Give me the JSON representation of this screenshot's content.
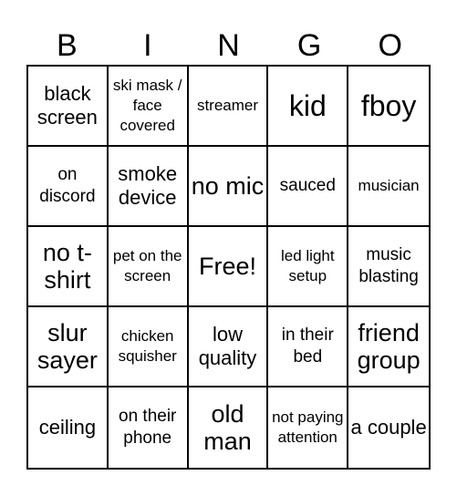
{
  "header": {
    "letters": [
      "B",
      "I",
      "N",
      "G",
      "O"
    ]
  },
  "board": {
    "rows": [
      [
        {
          "text": "black screen",
          "size": "m"
        },
        {
          "text": "ski mask / face covered",
          "size": "xs"
        },
        {
          "text": "streamer",
          "size": "xs"
        },
        {
          "text": "kid",
          "size": "xl"
        },
        {
          "text": "fboy",
          "size": "xl"
        }
      ],
      [
        {
          "text": "on discord",
          "size": "s"
        },
        {
          "text": "smoke device",
          "size": "m"
        },
        {
          "text": "no mic",
          "size": "l"
        },
        {
          "text": "sauced",
          "size": "s"
        },
        {
          "text": "musician",
          "size": "xs"
        }
      ],
      [
        {
          "text": "no t-shirt",
          "size": "l"
        },
        {
          "text": "pet on the screen",
          "size": "xs"
        },
        {
          "text": "Free!",
          "size": "l"
        },
        {
          "text": "led light setup",
          "size": "xs"
        },
        {
          "text": "music blasting",
          "size": "s"
        }
      ],
      [
        {
          "text": "slur sayer",
          "size": "l"
        },
        {
          "text": "chicken squisher",
          "size": "xs"
        },
        {
          "text": "low quality",
          "size": "m"
        },
        {
          "text": "in their bed",
          "size": "s"
        },
        {
          "text": "friend group",
          "size": "l"
        }
      ],
      [
        {
          "text": "ceiling",
          "size": "m"
        },
        {
          "text": "on their phone",
          "size": "s"
        },
        {
          "text": "old man",
          "size": "l"
        },
        {
          "text": "not paying attention",
          "size": "xs"
        },
        {
          "text": "a couple",
          "size": "m"
        }
      ]
    ]
  }
}
